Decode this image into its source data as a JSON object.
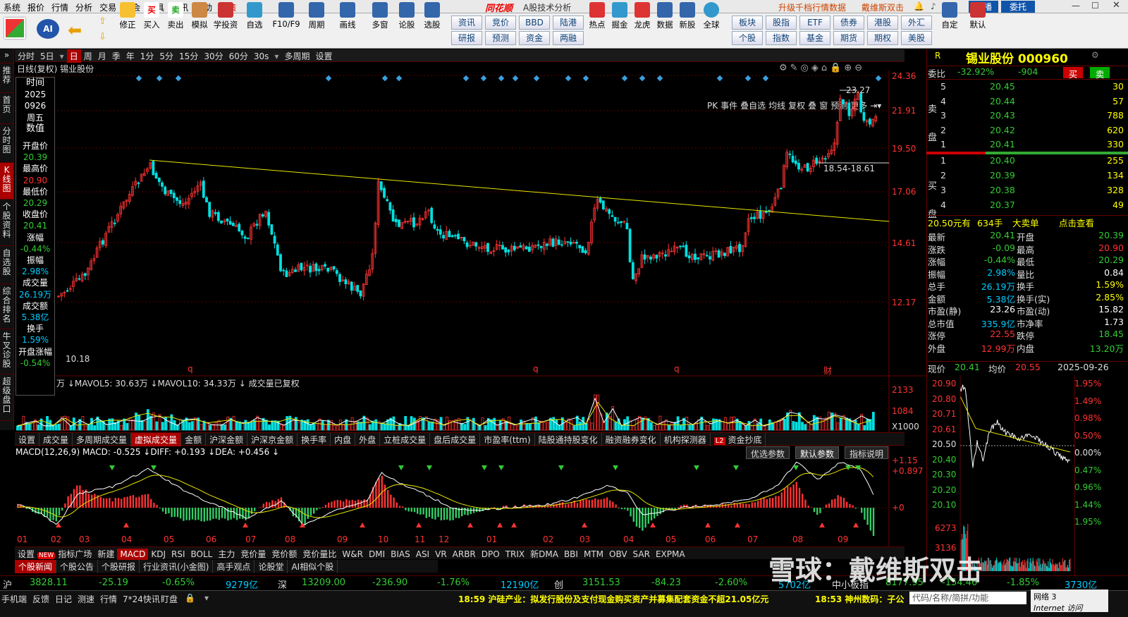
{
  "menu": [
    "系统",
    "报价",
    "行情",
    "分析",
    "交易",
    "机会",
    "工具",
    "资讯",
    "帮助",
    "决策"
  ],
  "app": {
    "logo": "同花顺",
    "subtitle": "A股技术分析",
    "link1": "升级千档行情数据",
    "link2": "戴维斯双击",
    "btn_zhibo": "直播",
    "btn_weituo": "委托"
  },
  "toolbar": [
    "修正",
    "买入",
    "卖出",
    "模拟",
    "学投资",
    "自选",
    "F10/F9",
    "周期",
    "画线",
    "多窗",
    "论股",
    "选股",
    "热点",
    "掘金",
    "龙虎",
    "数据",
    "新股",
    "全球",
    "自定",
    "默认"
  ],
  "toolgrid": [
    "资讯",
    "竞价",
    "BBD",
    "陆港",
    "研报",
    "预测",
    "资金",
    "两融",
    "板块",
    "股指",
    "ETF",
    "债券",
    "港股",
    "个股",
    "指数",
    "基金",
    "期货",
    "期权",
    "外汇",
    "美股"
  ],
  "leftnav": [
    "推荐",
    "首页",
    "分时图",
    "K线图",
    "个股资料",
    "自选股",
    "综合排名",
    "牛叉诊股",
    "超级盘口"
  ],
  "periods": [
    "分时",
    "5日",
    "日",
    "周",
    "月",
    "季",
    "年",
    "1分",
    "5分",
    "15分",
    "30分",
    "60分",
    "30s",
    "多周期",
    "设置"
  ],
  "right_tools": [
    "PK",
    "事件",
    "叠自选",
    "均线",
    "复权",
    "叠",
    "窗",
    "预测",
    "更多"
  ],
  "chart_title": "日线(复权)  锡业股份",
  "info": {
    "time_lbl": "时间",
    "year": "2025",
    "date": "0926",
    "weekday": "周五",
    "val_lbl": "数值",
    "open_lbl": "开盘价",
    "open": "20.39",
    "high_lbl": "最高价",
    "high": "20.90",
    "low_lbl": "最低价",
    "low": "20.29",
    "close_lbl": "收盘价",
    "close": "20.41",
    "chg_lbl": "涨幅",
    "chg": "-0.44%",
    "amp_lbl": "振幅",
    "amp": "2.98%",
    "vol_lbl": "成交量",
    "vol": "26.19万",
    "amt_lbl": "成交额",
    "amt": "5.38亿",
    "turn_lbl": "换手",
    "turn": "1.59%",
    "open_chg_lbl": "开盘涨幅",
    "open_chg": "-0.54%"
  },
  "price_axis": [
    "24.36",
    "21.91",
    "19.50",
    "17.06",
    "14.61",
    "12.17"
  ],
  "annotations": {
    "max": "23.27",
    "min": "10.18",
    "zone": "18.54-18.61",
    "cai": "财"
  },
  "vol_legend": "万 ↓MAVOL5: 30.63万 ↓MAVOL10: 34.33万 ↓ 成交量已复权",
  "vol_axis": [
    "2133",
    "1084",
    "X1000"
  ],
  "tabsA": [
    "设置",
    "成交量",
    "多周期成交量",
    "虚拟成交量",
    "金额",
    "沪深金额",
    "沪深京金额",
    "换手率",
    "内盘",
    "外盘",
    "立桩成交量",
    "盘后成交量",
    "市盈率(ttm)",
    "陆股通持股变化",
    "融资融券变化",
    "机构探测器",
    "资金抄底"
  ],
  "macd_legend": "MACD(12,26,9) MACD: -0.525 ↓DIFF: +0.193 ↓DEA: +0.456 ↓",
  "macd_btns": [
    "优选参数",
    "默认参数",
    "指标说明"
  ],
  "macd_axis": [
    "+1.15",
    "+0.897",
    "+0"
  ],
  "months": [
    "01",
    "02",
    "03",
    "04",
    "05",
    "06",
    "07",
    "08",
    "09",
    "10",
    "11",
    "12",
    "01",
    "02",
    "03",
    "04",
    "05",
    "06",
    "07",
    "08",
    "09"
  ],
  "tabsB": [
    "设置",
    "NEW",
    "指标广场",
    "新建",
    "MACD",
    "KDJ",
    "RSI",
    "BOLL",
    "主力",
    "竞价量",
    "竞价额",
    "竞价量比",
    "W&R",
    "DMI",
    "BIAS",
    "ASI",
    "VR",
    "ARBR",
    "DPO",
    "TRIX",
    "新DMA",
    "BBI",
    "MTM",
    "OBV",
    "SAR",
    "EXPMA"
  ],
  "news_tabs": [
    "个股新闻",
    "个股公告",
    "个股研报",
    "行业资讯(小金图)",
    "高手观点",
    "论股堂",
    "AI相似个股"
  ],
  "index_bar": {
    "sh_lbl": "沪",
    "sh": "3828.11",
    "sh_chg": "-25.19",
    "sh_pct": "-0.65%",
    "sh_amt": "9279亿",
    "sz_lbl": "深",
    "sz": "13209.00",
    "sz_chg": "-236.90",
    "sz_pct": "-1.76%",
    "sz_amt": "12190亿",
    "cy_lbl": "创",
    "cy": "3151.53",
    "cy_chg": "-84.23",
    "cy_pct": "-2.60%",
    "cy_amt": "5702亿",
    "zx_lbl": "中小板指",
    "zx": "8177.95",
    "zx_chg": "-154.46",
    "zx_pct": "-1.85%",
    "zx_amt": "3730亿"
  },
  "status": {
    "items": [
      "手机端",
      "反馈",
      "日记",
      "测速",
      "行情",
      "7*24快讯",
      "盯盘"
    ],
    "news1": "18:59 沪硅产业：拟发行股份及支付现金购买资产并募集配套资金不超21.05亿元",
    "news2": "18:53 神州数码：子公",
    "search": "代码/名称/简拼/功能",
    "net": "网络 3",
    "net2": "Internet 访问"
  },
  "stock": {
    "r": "R",
    "name": "锡业股份 000960",
    "wb_lbl": "委比",
    "wb": "-32.92%",
    "wc": "-904",
    "buy": "买",
    "sell": "卖",
    "sell_lbl": "卖盘",
    "buy_lbl": "买盘",
    "asks": [
      [
        "5",
        "20.45",
        "30"
      ],
      [
        "4",
        "20.44",
        "57"
      ],
      [
        "3",
        "20.43",
        "788"
      ],
      [
        "2",
        "20.42",
        "620"
      ],
      [
        "1",
        "20.41",
        "330"
      ]
    ],
    "bids": [
      [
        "1",
        "20.40",
        "255"
      ],
      [
        "2",
        "20.39",
        "134"
      ],
      [
        "3",
        "20.38",
        "328"
      ],
      [
        "4",
        "20.37",
        "49"
      ]
    ],
    "big_price": "20.50元有",
    "big_qty": "634手",
    "big_lbl": "大卖单",
    "big_link": "点击查看",
    "quote": [
      [
        "最新",
        "20.41",
        "开盘",
        "20.39"
      ],
      [
        "涨跌",
        "-0.09",
        "最高",
        "20.90"
      ],
      [
        "涨幅",
        "-0.44%",
        "最低",
        "20.29"
      ],
      [
        "振幅",
        "2.98%",
        "量比",
        "0.84"
      ],
      [
        "总手",
        "26.19万",
        "换手",
        "1.59%"
      ],
      [
        "金额",
        "5.38亿",
        "换手(实)",
        "2.85%"
      ],
      [
        "市盈(静)",
        "23.26",
        "市盈(动)",
        "15.82"
      ],
      [
        "总市值",
        "335.9亿",
        "市净率",
        "1.73"
      ],
      [
        "涨停",
        "22.55",
        "跌停",
        "18.45"
      ],
      [
        "外盘",
        "12.99万",
        "内盘",
        "13.20万"
      ]
    ],
    "now_lbl": "现价",
    "now": "20.41",
    "avg_lbl": "均价",
    "avg": "20.55",
    "date": "2025-09-26",
    "intraday_axis": [
      "20.90",
      "20.80",
      "20.71",
      "20.61",
      "20.50",
      "20.40",
      "20.30",
      "20.20",
      "20.10"
    ],
    "intraday_pct": [
      "1.95%",
      "1.49%",
      "0.98%",
      "0.50%",
      "0.00%",
      "0.47%",
      "0.96%",
      "1.44%",
      "1.95%"
    ],
    "intraday_vol": [
      "6273",
      "3136"
    ]
  },
  "watermark": "雪球：戴维斯双击",
  "colors": {
    "up": "#ff3333",
    "down": "#33cc66",
    "bg": "#000000",
    "accent": "#aa0000",
    "trend": "#e6e600"
  }
}
